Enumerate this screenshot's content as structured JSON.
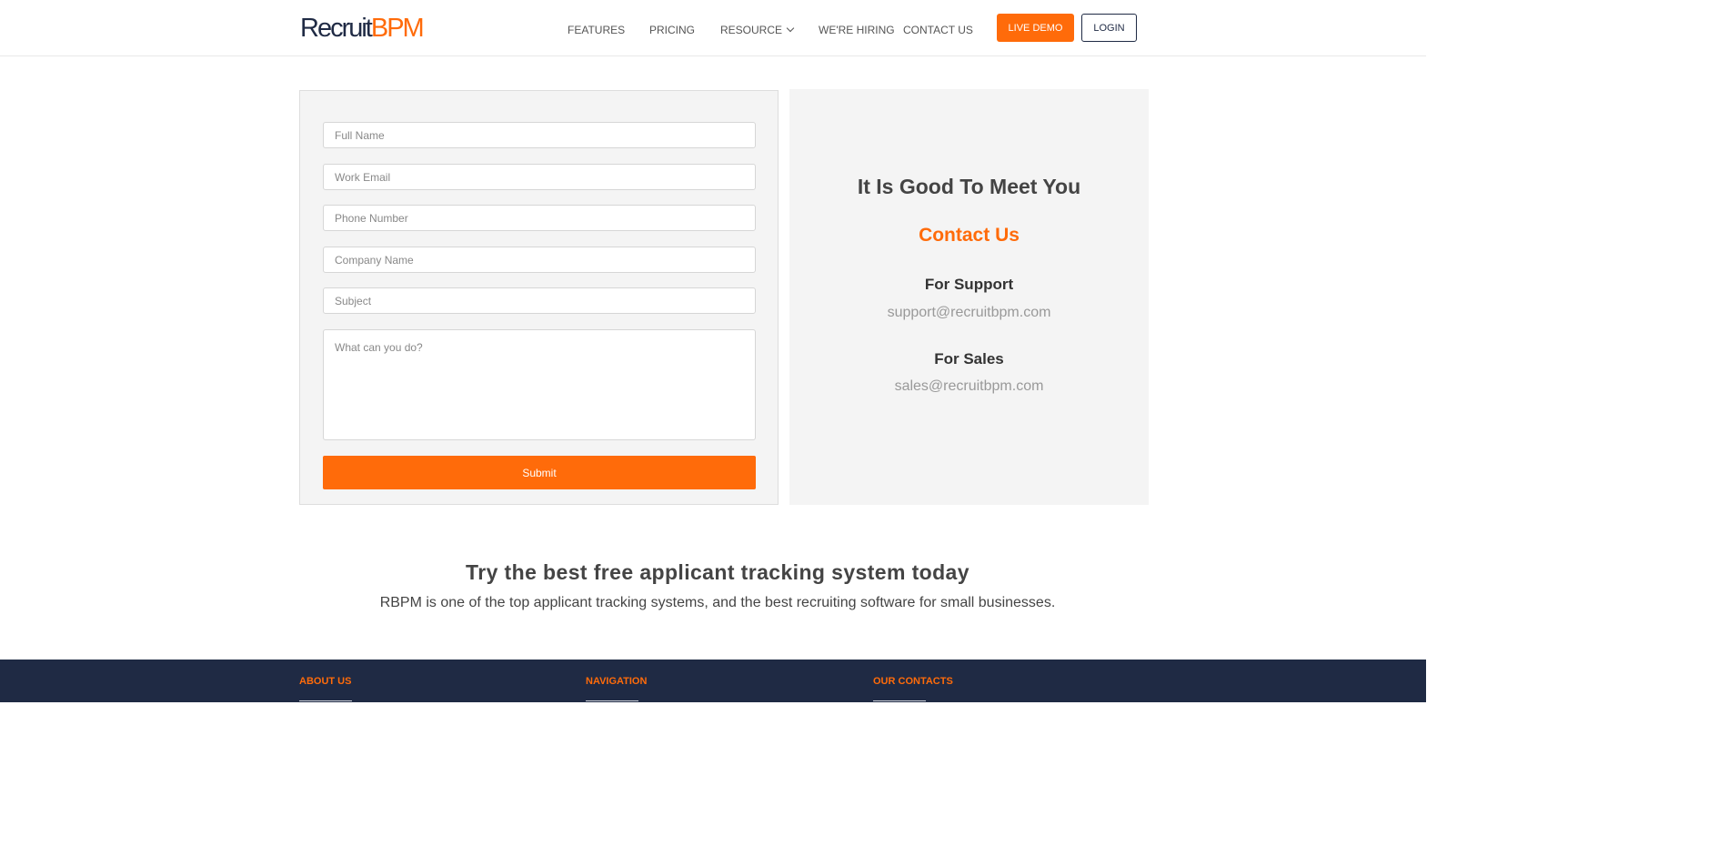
{
  "header": {
    "logo_part1": "Recruit",
    "logo_part2": "BPM",
    "nav": {
      "features": "FEATURES",
      "pricing": "PRICING",
      "resource": "RESOURCE",
      "hiring": "WE'RE HIRING",
      "contact": "CONTACT US"
    },
    "live_demo": "LIVE DEMO",
    "login": "LOGIN"
  },
  "form": {
    "full_name_placeholder": "Full Name",
    "work_email_placeholder": "Work Email",
    "phone_placeholder": "Phone Number",
    "company_placeholder": "Company Name",
    "subject_placeholder": "Subject",
    "message_placeholder": "What can you do?",
    "submit_label": "Submit"
  },
  "info": {
    "greeting": "It Is Good To Meet You",
    "contact_title": "Contact Us",
    "support_label": "For Support",
    "support_email": "support@recruitbpm.com",
    "sales_label": "For Sales",
    "sales_email": "sales@recruitbpm.com"
  },
  "cta": {
    "title": "Try the best free applicant tracking system today",
    "text": "RBPM is one of the top applicant tracking systems, and the best recruiting software for small businesses."
  },
  "footer": {
    "about": "ABOUT US",
    "navigation": "NAVIGATION",
    "contacts": "OUR CONTACTS"
  },
  "colors": {
    "accent": "#ff6b0a",
    "navy": "#1f2a44",
    "panel": "#f4f4f4"
  }
}
